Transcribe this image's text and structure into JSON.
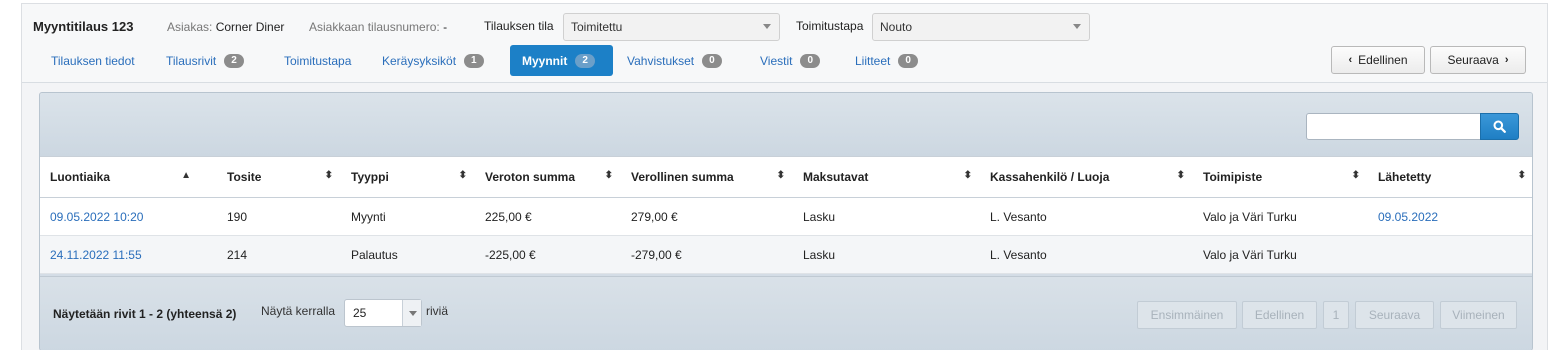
{
  "order": {
    "title": "Myyntitilaus 123",
    "customer_label": "Asiakas:",
    "customer_value": "Corner Diner",
    "customer_order_no_label": "Asiakkaan tilausnumero:",
    "customer_order_no_value": "-",
    "status_label": "Tilauksen tila",
    "status_value": "Toimitettu",
    "delivery_label": "Toimitustapa",
    "delivery_value": "Nouto"
  },
  "tabs": [
    {
      "label": "Tilauksen tiedot",
      "badge": ""
    },
    {
      "label": "Tilausrivit",
      "badge": "2"
    },
    {
      "label": "Toimitustapa",
      "badge": ""
    },
    {
      "label": "Keräysyksiköt",
      "badge": "1"
    },
    {
      "label": "Myynnit",
      "badge": "2",
      "active": true
    },
    {
      "label": "Vahvistukset",
      "badge": "0"
    },
    {
      "label": "Viestit",
      "badge": "0"
    },
    {
      "label": "Liitteet",
      "badge": "0"
    }
  ],
  "nav": {
    "prev_label": "Edellinen",
    "next_label": "Seuraava"
  },
  "search": {
    "placeholder": ""
  },
  "table": {
    "columns": [
      "Luontiaika",
      "Tosite",
      "Tyyppi",
      "Veroton summa",
      "Verollinen summa",
      "Maksutavat",
      "Kassahenkilö / Luoja",
      "Toimipiste",
      "Lähetetty"
    ],
    "sorted_column": "Luontiaika",
    "rows": [
      [
        "09.05.2022 10:20",
        "190",
        "Myynti",
        "225,00 €",
        "279,00 €",
        "Lasku",
        "L. Vesanto",
        "Valo ja Väri Turku",
        "09.05.2022"
      ],
      [
        "24.11.2022 11:55",
        "214",
        "Palautus",
        "-225,00 €",
        "-279,00 €",
        "Lasku",
        "L. Vesanto",
        "Valo ja Väri Turku",
        ""
      ]
    ]
  },
  "pagination": {
    "info": "Näytetään rivit 1 - 2 (yhteensä 2)",
    "per_page_label": "Näytä kerralla",
    "per_page_value": "25",
    "per_page_suffix": "riviä",
    "first_label": "Ensimmäinen",
    "prev_label": "Edellinen",
    "page": "1",
    "next_label": "Seuraava",
    "last_label": "Viimeinen"
  },
  "colors": {
    "accent": "#1c80c7",
    "link": "#2a6ebb"
  },
  "icons": {
    "search": "search-icon",
    "sort_asc": "sort-asc-icon",
    "sort_both": "sort-icon"
  }
}
